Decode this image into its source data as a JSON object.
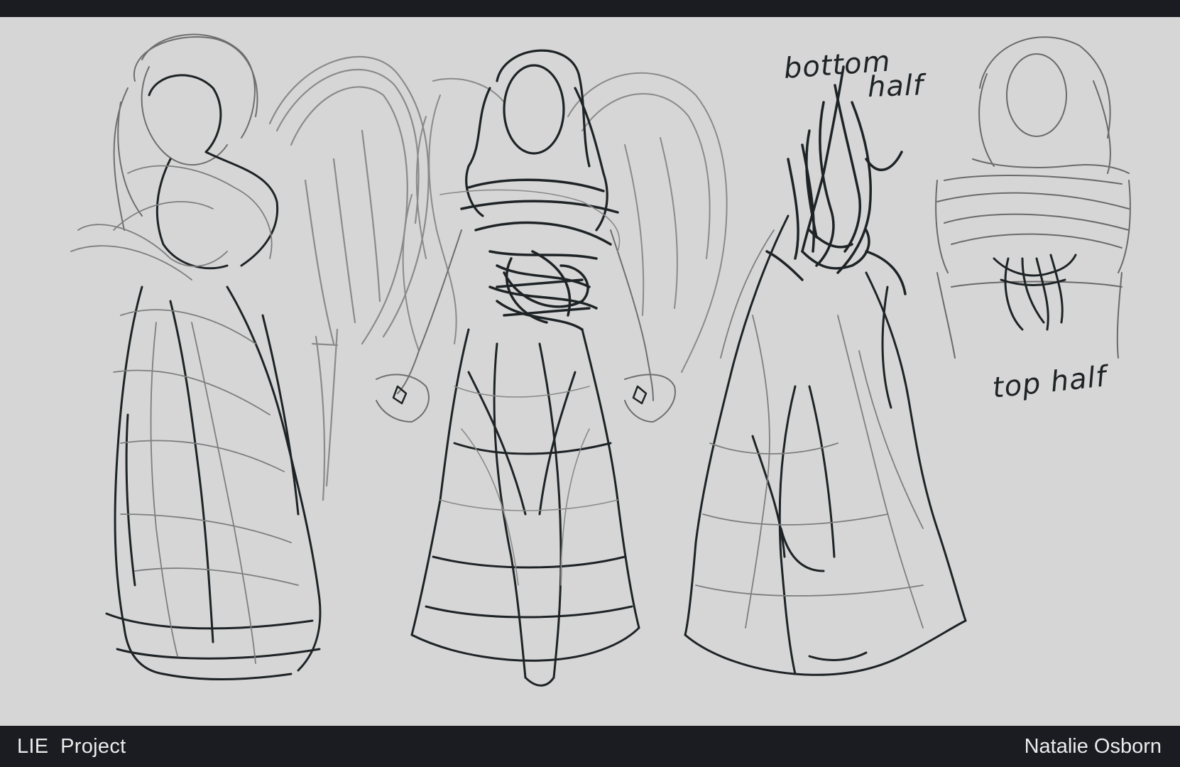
{
  "header": {},
  "canvas": {
    "labels": {
      "bottom_half_line1": "bottom",
      "bottom_half_line2": "half",
      "top_half": "top half"
    },
    "figures": [
      {
        "name": "figure-side-with-wings"
      },
      {
        "name": "figure-front-with-wings"
      },
      {
        "name": "figure-back-bottom-half"
      },
      {
        "name": "figure-top-half-bust"
      }
    ]
  },
  "footer": {
    "project_title": "LIE  Project",
    "artist_name": "Natalie Osborn"
  },
  "colors": {
    "bar": "#1a1c21",
    "canvas": "#d6d6d6",
    "ink_dark": "#1e2326",
    "ink_light": "#7a7a7a",
    "footer_text": "#ececec"
  }
}
